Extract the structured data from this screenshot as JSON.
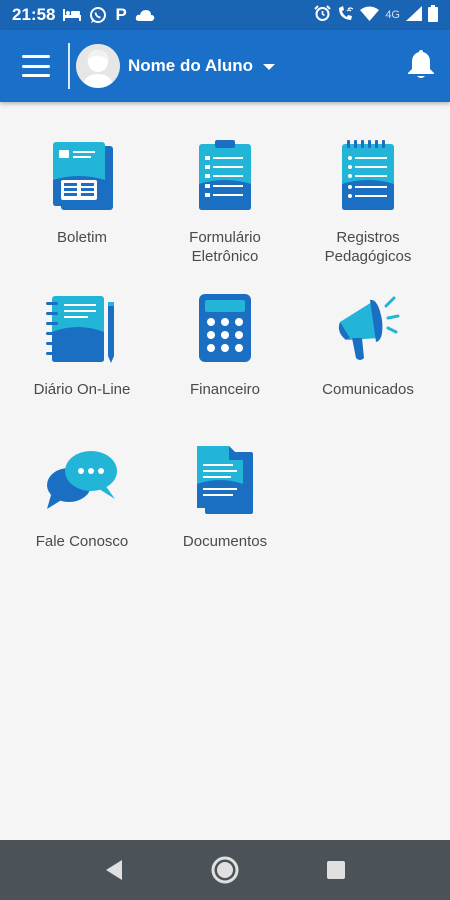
{
  "status_bar": {
    "time": "21:58",
    "network_label": "4G",
    "icons": [
      "bed-icon",
      "whatsapp-icon",
      "parking-icon",
      "cloud-icon",
      "alarm-icon",
      "wifi-call-icon",
      "wifi-icon",
      "signal-icon",
      "battery-icon"
    ]
  },
  "app_bar": {
    "menu_icon": "hamburger-menu-icon",
    "user_name": "Nome do Aluno",
    "dropdown_icon": "caret-down-icon",
    "notifications_icon": "bell-icon"
  },
  "menu": {
    "items": [
      {
        "label": "Boletim",
        "icon": "report-card-icon"
      },
      {
        "label": "Formulário\nEletrônico",
        "icon": "clipboard-form-icon"
      },
      {
        "label": "Registros\nPedagógicos",
        "icon": "notepad-icon"
      },
      {
        "label": "Diário On-Line",
        "icon": "notebook-pen-icon"
      },
      {
        "label": "Financeiro",
        "icon": "calculator-icon"
      },
      {
        "label": "Comunicados",
        "icon": "megaphone-icon"
      },
      {
        "label": "Fale Conosco",
        "icon": "chat-bubbles-icon"
      },
      {
        "label": "Documentos",
        "icon": "documents-icon"
      }
    ]
  },
  "nav_bar": {
    "back_icon": "back-triangle-icon",
    "home_icon": "home-circle-icon",
    "recents_icon": "recents-square-icon"
  },
  "colors": {
    "status_bar": "#1a64b4",
    "app_bar": "#1a6fc8",
    "icon_dark": "#1b6fc2",
    "icon_light": "#22b5d8",
    "label_text": "#4a4a4a",
    "background": "#f5f5f5",
    "nav_bar": "#4b5358"
  }
}
